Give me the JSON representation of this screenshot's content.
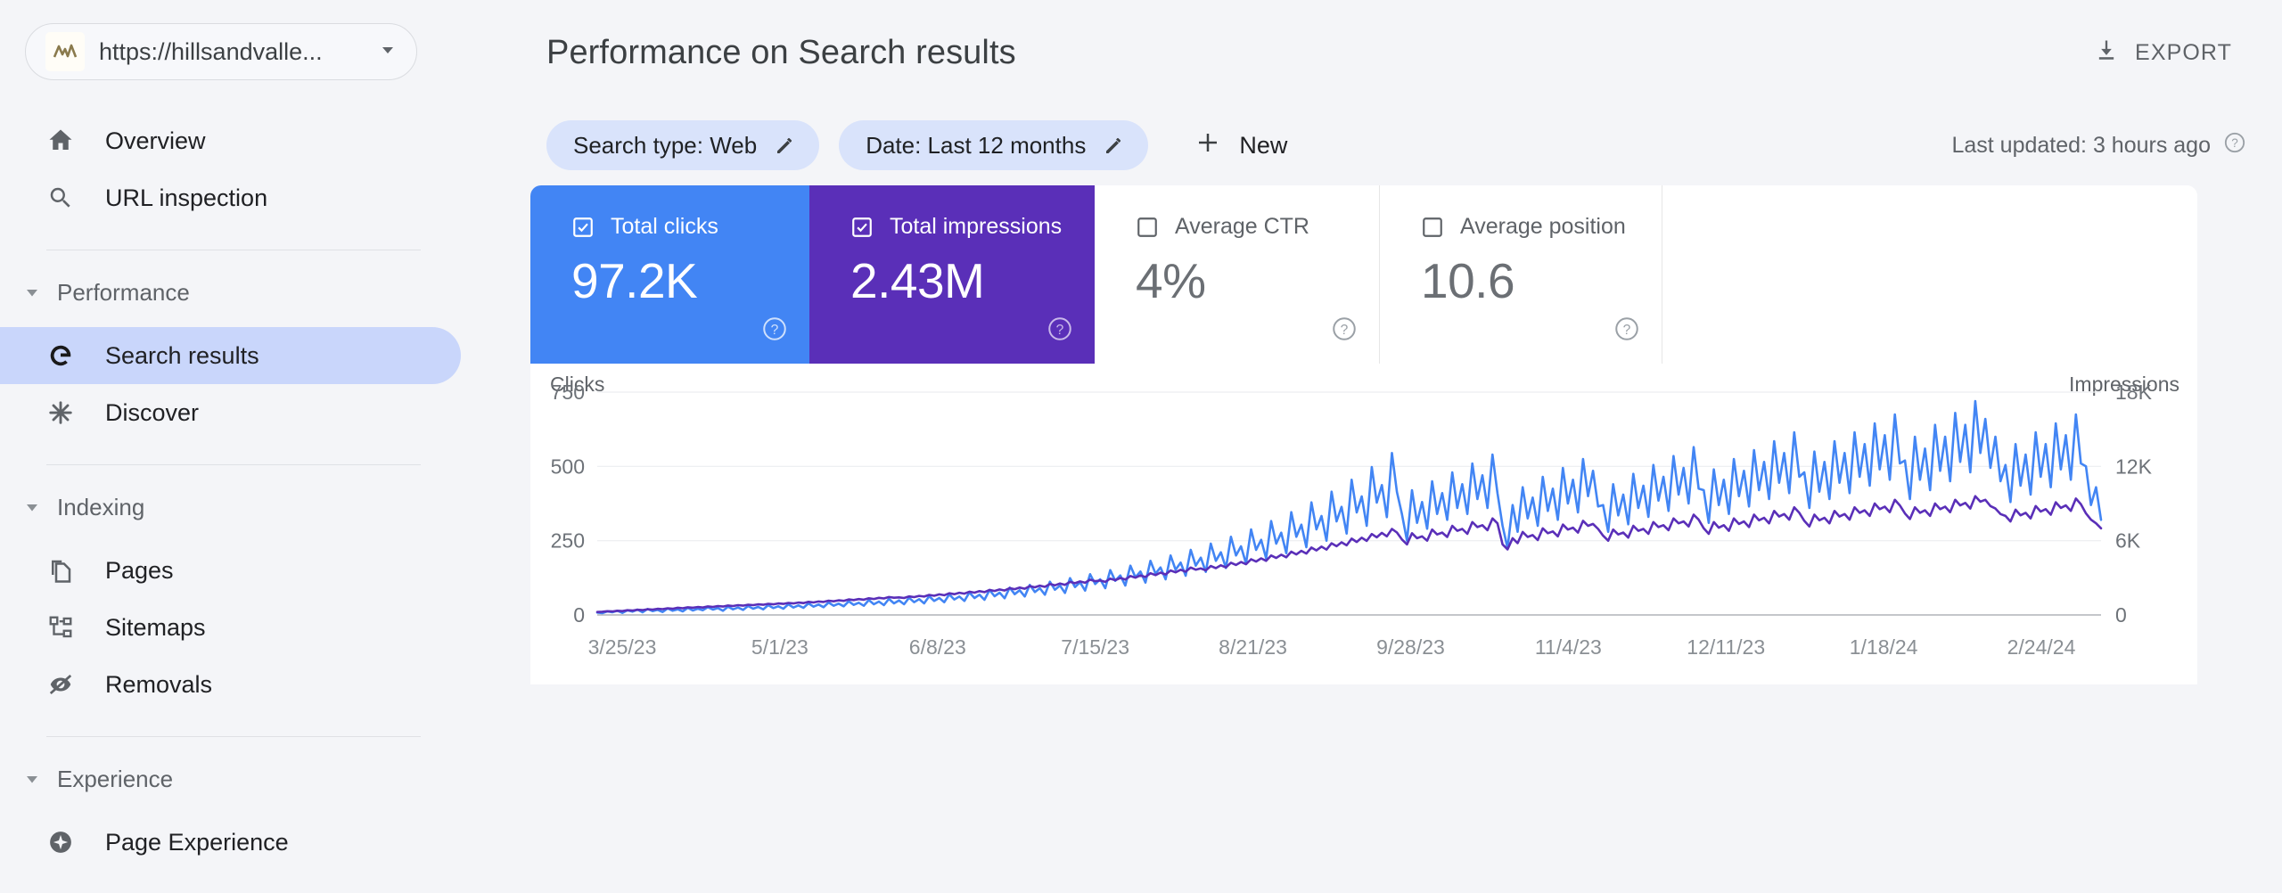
{
  "sidebar": {
    "property": {
      "url": "https://hillsandvalle...",
      "favicon_icon": "mountain-chart-favicon",
      "caret_icon": "chevron-down-icon"
    },
    "items": [
      {
        "label": "Overview",
        "icon": "home-icon",
        "active": false
      },
      {
        "label": "URL inspection",
        "icon": "search-icon",
        "active": false
      }
    ],
    "groups": [
      {
        "label": "Performance",
        "caret_icon": "caret-down-icon",
        "items": [
          {
            "label": "Search results",
            "icon": "google-g-icon",
            "active": true
          },
          {
            "label": "Discover",
            "icon": "asterisk-icon",
            "active": false
          }
        ]
      },
      {
        "label": "Indexing",
        "caret_icon": "caret-down-icon",
        "items": [
          {
            "label": "Pages",
            "icon": "pages-copy-icon",
            "active": false
          },
          {
            "label": "Sitemaps",
            "icon": "sitemap-tree-icon",
            "active": false
          },
          {
            "label": "Removals",
            "icon": "eye-off-icon",
            "active": false
          }
        ]
      },
      {
        "label": "Experience",
        "caret_icon": "caret-down-icon",
        "items": [
          {
            "label": "Page Experience",
            "icon": "sparkle-circle-icon",
            "active": false
          }
        ]
      }
    ]
  },
  "header": {
    "title": "Performance on Search results",
    "export_label": "EXPORT",
    "export_icon": "download-icon"
  },
  "filters": {
    "chips": [
      {
        "label": "Search type: Web",
        "edit_icon": "pencil-icon"
      },
      {
        "label": "Date: Last 12 months",
        "edit_icon": "pencil-icon"
      }
    ],
    "new_label": "New",
    "new_icon": "plus-icon",
    "last_updated": "Last updated: 3 hours ago",
    "last_updated_icon": "help-circle-icon"
  },
  "metrics": [
    {
      "label": "Total clicks",
      "value": "97.2K",
      "checked": true,
      "color": "#4285f4",
      "help_icon": "help-circle-icon"
    },
    {
      "label": "Total impressions",
      "value": "2.43M",
      "checked": true,
      "color": "#5a2fb8",
      "help_icon": "help-circle-icon"
    },
    {
      "label": "Average CTR",
      "value": "4%",
      "checked": false,
      "color": "#ffffff",
      "help_icon": "help-circle-icon"
    },
    {
      "label": "Average position",
      "value": "10.6",
      "checked": false,
      "color": "#ffffff",
      "help_icon": "help-circle-icon"
    }
  ],
  "chart_data": {
    "type": "line",
    "title": "",
    "grid": true,
    "legend_position": "none",
    "left_axis": {
      "label": "Clicks",
      "ticks": [
        "0",
        "250",
        "500",
        "750"
      ],
      "ylim": [
        0,
        750
      ]
    },
    "right_axis": {
      "label": "Impressions",
      "ticks": [
        "0",
        "6K",
        "12K",
        "18K"
      ],
      "ylim": [
        0,
        18000
      ]
    },
    "xlabel": "",
    "x_tick_labels": [
      "3/25/23",
      "5/1/23",
      "6/8/23",
      "7/15/23",
      "8/21/23",
      "9/28/23",
      "11/4/23",
      "12/11/23",
      "1/18/24",
      "2/24/24"
    ],
    "series": [
      {
        "name": "Total clicks",
        "color": "#4285f4",
        "axis": "left",
        "values": [
          8,
          6,
          12,
          9,
          14,
          7,
          16,
          11,
          18,
          9,
          20,
          13,
          17,
          10,
          22,
          14,
          19,
          12,
          24,
          15,
          21,
          16,
          26,
          18,
          23,
          14,
          28,
          19,
          25,
          17,
          30,
          21,
          27,
          19,
          33,
          23,
          29,
          21,
          36,
          25,
          32,
          24,
          39,
          28,
          35,
          26,
          42,
          31,
          38,
          29,
          46,
          34,
          41,
          31,
          50,
          36,
          45,
          33,
          54,
          39,
          49,
          36,
          58,
          43,
          53,
          39,
          63,
          47,
          57,
          43,
          69,
          52,
          62,
          47,
          76,
          57,
          68,
          51,
          84,
          63,
          75,
          56,
          92,
          70,
          83,
          62,
          101,
          77,
          90,
          68,
          112,
          85,
          99,
          74,
          124,
          94,
          110,
          82,
          137,
          104,
          120,
          90,
          151,
          115,
          133,
          99,
          166,
          127,
          146,
          109,
          182,
          139,
          160,
          120,
          200,
          152,
          176,
          132,
          219,
          166,
          193,
          145,
          240,
          182,
          211,
          158,
          263,
          200,
          231,
          173,
          288,
          219,
          253,
          190,
          316,
          240,
          277,
          208,
          346,
          263,
          304,
          228,
          379,
          288,
          333,
          250,
          415,
          315,
          364,
          274,
          455,
          345,
          399,
          300,
          498,
          378,
          437,
          329,
          545,
          414,
          340,
          250,
          420,
          310,
          380,
          290,
          450,
          340,
          410,
          320,
          480,
          360,
          440,
          340,
          510,
          390,
          470,
          360,
          540,
          410,
          300,
          225,
          370,
          280,
          430,
          325,
          395,
          300,
          465,
          350,
          425,
          320,
          495,
          375,
          455,
          345,
          525,
          400,
          485,
          365,
          370,
          280,
          440,
          335,
          405,
          305,
          475,
          360,
          435,
          330,
          505,
          385,
          465,
          350,
          535,
          405,
          495,
          375,
          565,
          425,
          420,
          310,
          490,
          370,
          455,
          340,
          525,
          400,
          485,
          365,
          555,
          420,
          515,
          390,
          585,
          445,
          545,
          410,
          615,
          465,
          480,
          360,
          550,
          415,
          515,
          390,
          585,
          445,
          545,
          410,
          615,
          465,
          575,
          435,
          645,
          490,
          605,
          455,
          675,
          510,
          520,
          390,
          600,
          455,
          560,
          420,
          640,
          485,
          600,
          450,
          680,
          515,
          640,
          480,
          720,
          545,
          660,
          495,
          600,
          450,
          505,
          380,
          575,
          435,
          540,
          405,
          615,
          465,
          575,
          430,
          645,
          490,
          605,
          455,
          675,
          510,
          500,
          370,
          430,
          320
        ],
        "max_value": 720
      },
      {
        "name": "Total impressions",
        "color": "#5a2fb8",
        "axis": "right",
        "values": [
          240,
          260,
          300,
          280,
          340,
          310,
          380,
          350,
          420,
          390,
          460,
          430,
          500,
          470,
          540,
          500,
          580,
          540,
          620,
          580,
          640,
          600,
          690,
          650,
          720,
          680,
          760,
          720,
          790,
          750,
          830,
          790,
          860,
          820,
          900,
          860,
          930,
          890,
          970,
          930,
          1000,
          960,
          1060,
          1010,
          1090,
          1050,
          1150,
          1100,
          1180,
          1140,
          1250,
          1200,
          1280,
          1230,
          1350,
          1290,
          1380,
          1330,
          1450,
          1390,
          1420,
          1370,
          1500,
          1440,
          1540,
          1480,
          1620,
          1550,
          1660,
          1590,
          1750,
          1680,
          1790,
          1720,
          1880,
          1800,
          1920,
          1840,
          2020,
          1940,
          2060,
          1970,
          2170,
          2080,
          2210,
          2120,
          2330,
          2230,
          2370,
          2270,
          2500,
          2390,
          2540,
          2430,
          2670,
          2560,
          2710,
          2600,
          2850,
          2730,
          2790,
          2670,
          2940,
          2810,
          2990,
          2860,
          3150,
          3010,
          3200,
          3060,
          3370,
          3220,
          3420,
          3270,
          3590,
          3440,
          3650,
          3490,
          3830,
          3660,
          3760,
          3600,
          3950,
          3780,
          4010,
          3840,
          4220,
          4040,
          4280,
          4100,
          4500,
          4310,
          4570,
          4370,
          4800,
          4600,
          4870,
          4660,
          5110,
          4890,
          5180,
          4960,
          5440,
          5210,
          5520,
          5280,
          5790,
          5550,
          5870,
          5620,
          6160,
          5900,
          6240,
          5980,
          6540,
          6270,
          6630,
          6350,
          6950,
          6660,
          6100,
          5700,
          6600,
          6200,
          6350,
          6000,
          6900,
          6500,
          6650,
          6300,
          7200,
          6800,
          6950,
          6550,
          7500,
          7100,
          7250,
          6850,
          7800,
          7400,
          5700,
          5300,
          6200,
          5800,
          6700,
          6300,
          6450,
          6050,
          7000,
          6600,
          6750,
          6350,
          7300,
          6900,
          7050,
          6650,
          7600,
          7200,
          7350,
          6950,
          6400,
          6000,
          6900,
          6500,
          6650,
          6250,
          7200,
          6800,
          6950,
          6550,
          7500,
          7100,
          7250,
          6850,
          7800,
          7400,
          7550,
          7150,
          8100,
          7700,
          7000,
          6550,
          7500,
          7050,
          7250,
          6800,
          7800,
          7350,
          7550,
          7100,
          8100,
          7650,
          7850,
          7400,
          8400,
          7950,
          8150,
          7700,
          8700,
          8250,
          7600,
          7150,
          8100,
          7650,
          7850,
          7400,
          8400,
          7950,
          8150,
          7700,
          8700,
          8250,
          8450,
          8000,
          9000,
          8550,
          8750,
          8300,
          9300,
          8850,
          8200,
          7750,
          8700,
          8250,
          8450,
          8000,
          9000,
          8550,
          8750,
          8300,
          9300,
          8850,
          9050,
          8600,
          9600,
          9150,
          9300,
          8800,
          8600,
          8150,
          8000,
          7550,
          8500,
          8050,
          8250,
          7800,
          8800,
          8350,
          8550,
          8100,
          9100,
          8650,
          8850,
          8400,
          9400,
          8950,
          8200,
          7700,
          7400,
          7000
        ],
        "max_value": 9600
      }
    ]
  }
}
